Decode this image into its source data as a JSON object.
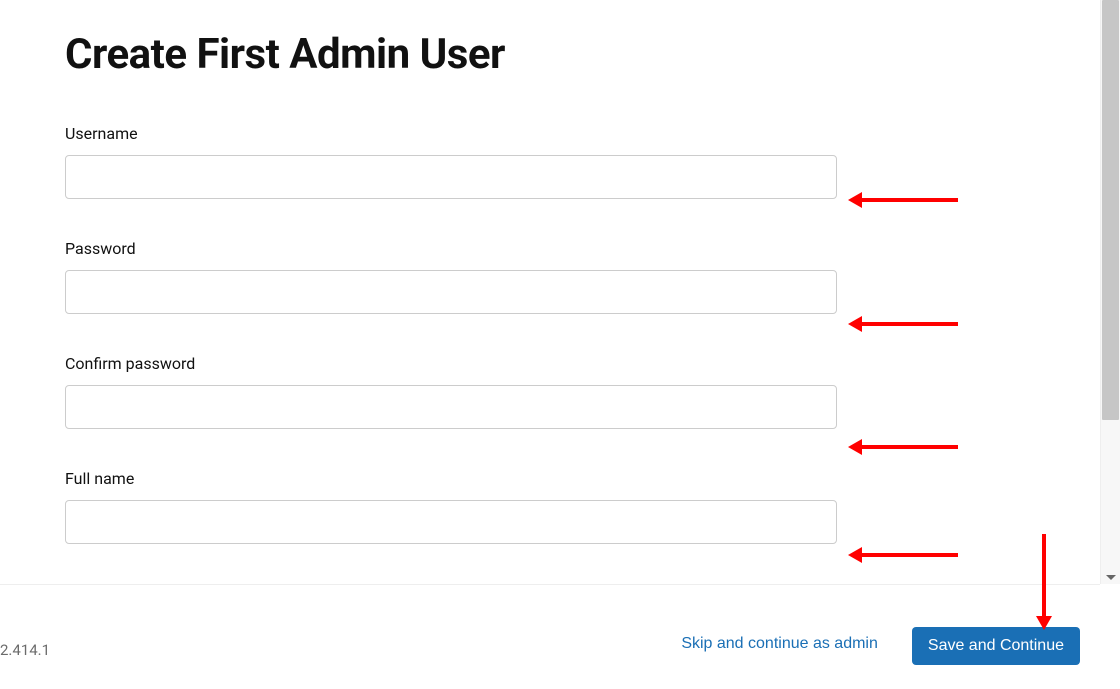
{
  "page": {
    "title": "Create First Admin User"
  },
  "form": {
    "username": {
      "label": "Username",
      "value": ""
    },
    "password": {
      "label": "Password",
      "value": ""
    },
    "confirm_password": {
      "label": "Confirm password",
      "value": ""
    },
    "full_name": {
      "label": "Full name",
      "value": ""
    }
  },
  "footer": {
    "version": "2.414.1",
    "skip_label": "Skip and continue as admin",
    "save_label": "Save and Continue"
  }
}
